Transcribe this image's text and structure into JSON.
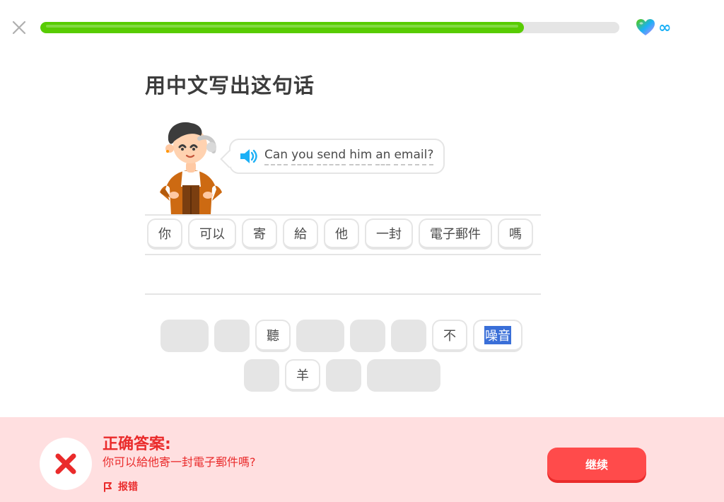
{
  "header": {
    "progress_fraction": 0.835,
    "hearts_value": "∞"
  },
  "prompt": {
    "title": "用中文写出这句话",
    "sentence_words": [
      "Can",
      "you",
      "send",
      "him",
      "an",
      "email?"
    ]
  },
  "answer_tiles": [
    "你",
    "可以",
    "寄",
    "給",
    "他",
    "一封",
    "電子郵件",
    "嗎"
  ],
  "word_bank": {
    "row1": [
      {
        "text": "",
        "width": 68
      },
      {
        "text": "",
        "width": 50
      },
      {
        "text": "聽"
      },
      {
        "text": "",
        "width": 68
      },
      {
        "text": "",
        "width": 50
      },
      {
        "text": "",
        "width": 50
      },
      {
        "text": "不"
      },
      {
        "text": "噪音",
        "selected": true
      }
    ],
    "row2": [
      {
        "text": "",
        "width": 50
      },
      {
        "text": "羊"
      },
      {
        "text": "",
        "width": 50
      },
      {
        "text": "",
        "width": 104
      }
    ]
  },
  "feedback": {
    "title": "正确答案:",
    "correct_answer": "你可以給他寄一封電子郵件嗎?",
    "report_label": "报错",
    "continue_label": "继续"
  },
  "colors": {
    "progress": "#58cc02",
    "error_bg": "#ffdfe0",
    "error_text": "#ea2b2b",
    "continue_button": "#ff4b4b",
    "infinity": "#1cb0f6"
  }
}
